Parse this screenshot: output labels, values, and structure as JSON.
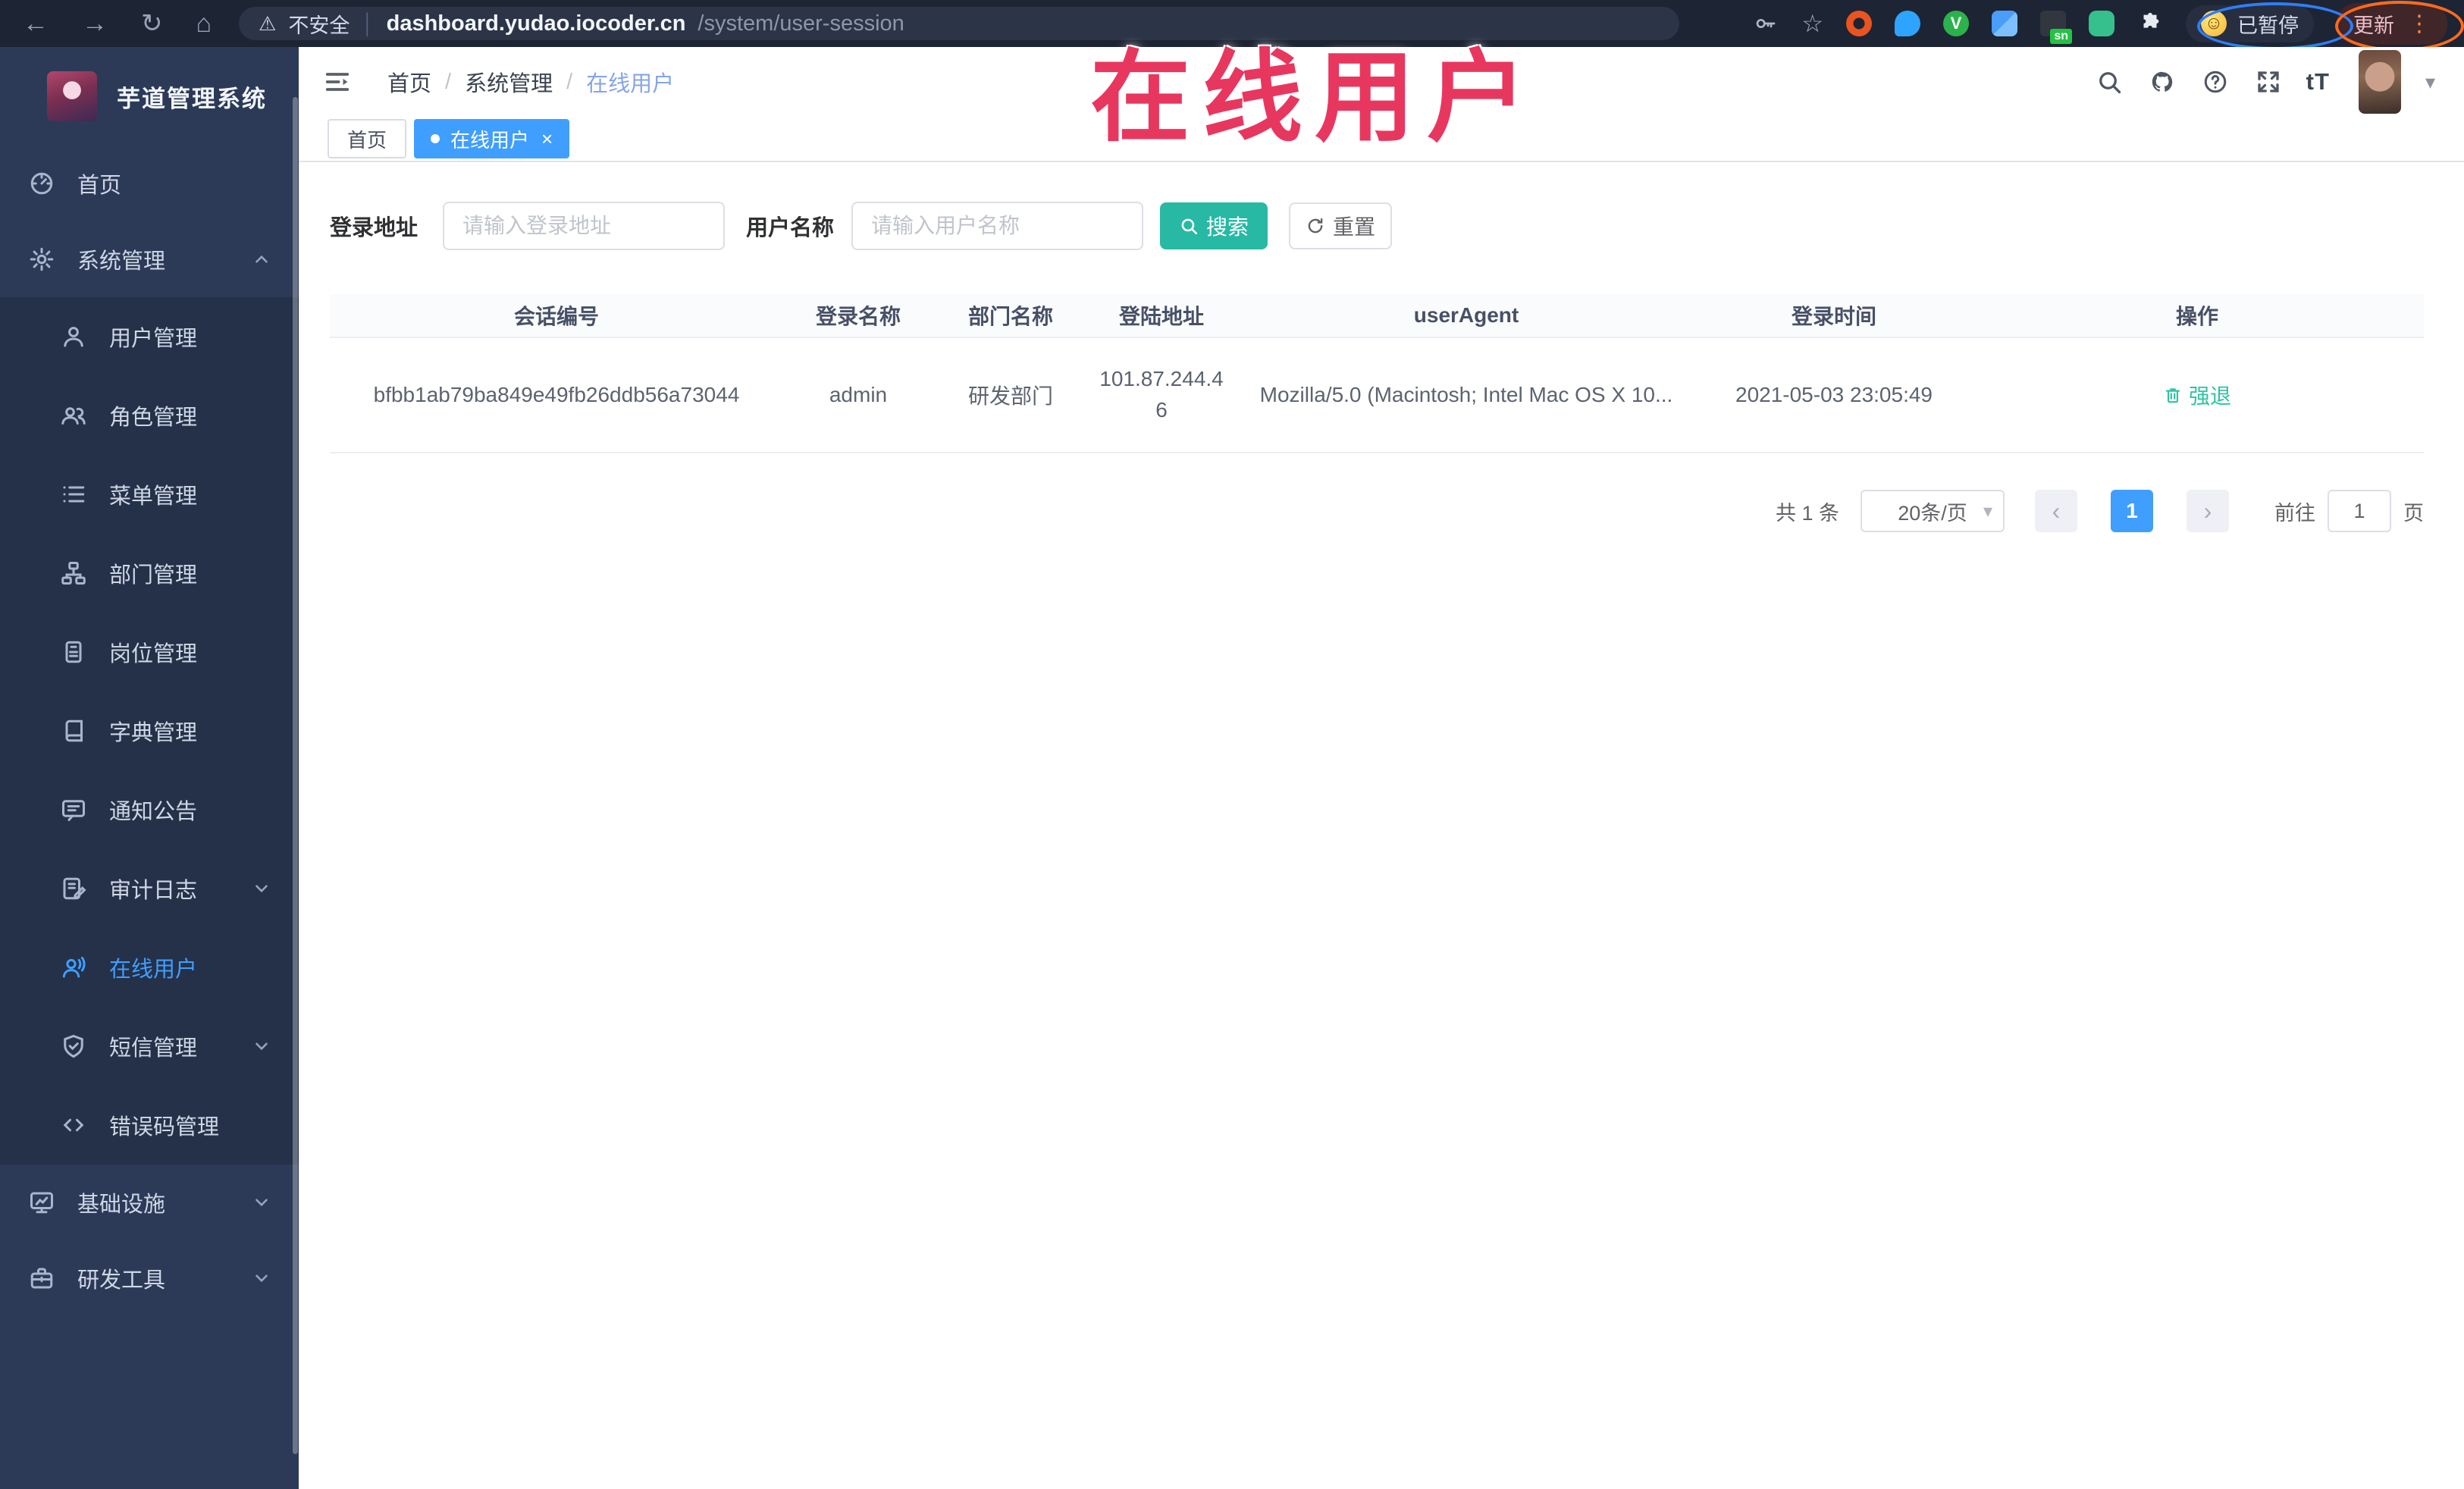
{
  "browser": {
    "security_label": "不安全",
    "url_host": "dashboard.yudao.iocoder.cn",
    "url_path": "/system/user-session",
    "extension_badge": "sn",
    "paused_label": "已暂停",
    "update_label": "更新"
  },
  "annotation": {
    "title": "在线用户",
    "color": "#e8375f"
  },
  "sidebar": {
    "title": "芋道管理系统",
    "items": [
      {
        "label": "首页"
      },
      {
        "label": "系统管理",
        "expanded": true
      },
      {
        "label": "用户管理"
      },
      {
        "label": "角色管理"
      },
      {
        "label": "菜单管理"
      },
      {
        "label": "部门管理"
      },
      {
        "label": "岗位管理"
      },
      {
        "label": "字典管理"
      },
      {
        "label": "通知公告"
      },
      {
        "label": "审计日志"
      },
      {
        "label": "在线用户",
        "active": true
      },
      {
        "label": "短信管理"
      },
      {
        "label": "错误码管理"
      },
      {
        "label": "基础设施"
      },
      {
        "label": "研发工具"
      }
    ]
  },
  "header": {
    "breadcrumb": [
      "首页",
      "系统管理",
      "在线用户"
    ]
  },
  "tabs": [
    {
      "label": "首页",
      "active": false
    },
    {
      "label": "在线用户",
      "active": true
    }
  ],
  "filters": {
    "login_address_label": "登录地址",
    "login_address_placeholder": "请输入登录地址",
    "username_label": "用户名称",
    "username_placeholder": "请输入用户名称",
    "search_label": "搜索",
    "reset_label": "重置"
  },
  "table": {
    "columns": [
      "会话编号",
      "登录名称",
      "部门名称",
      "登陆地址",
      "userAgent",
      "登录时间",
      "操作"
    ],
    "rows": [
      {
        "session_id": "bfbb1ab79ba849e49fb26ddb56a73044",
        "login_name": "admin",
        "dept_name": "研发部门",
        "login_ip": "101.87.244.46",
        "user_agent": "Mozilla/5.0 (Macintosh; Intel Mac OS X 10...",
        "login_time": "2021-05-03 23:05:49",
        "action_label": "强退"
      }
    ]
  },
  "pagination": {
    "total": "共 1 条",
    "page_size": "20条/页",
    "current_page": "1",
    "goto_label": "前往",
    "goto_value": "1",
    "page_unit": "页"
  },
  "icons": {
    "back": "←",
    "forward": "→",
    "reload": "↻",
    "home": "⌂",
    "warning": "⚠",
    "star": "☆",
    "overflow": "⋮",
    "caret_down": "▾",
    "close": "×",
    "prev": "‹",
    "next": "›",
    "divider": "│",
    "font_size": "tT",
    "smiley": "☺",
    "letter_v": "V"
  },
  "colors": {
    "accent_blue": "#409eff",
    "teal": "#27b9a4",
    "success_green": "#2fc3a2",
    "annotation_red": "#e8375f",
    "sidebar_bg": "#2c3a58",
    "submenu_bg": "#243149"
  }
}
